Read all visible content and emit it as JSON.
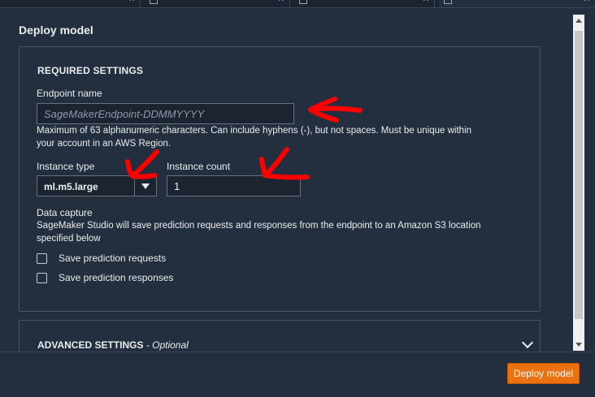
{
  "tabs": [
    {
      "name": "...",
      "active": false
    },
    {
      "name": "...",
      "active": false
    },
    {
      "name": "...",
      "active": false
    },
    {
      "name": "...",
      "active": true
    }
  ],
  "dialog": {
    "title": "Deploy model"
  },
  "required": {
    "section_title": "REQUIRED SETTINGS",
    "endpoint_label": "Endpoint name",
    "endpoint_placeholder": "SageMakerEndpoint-DDMMYYYY",
    "endpoint_hint_line1": "Maximum of 63 alphanumeric characters. Can include hyphens (-), but not spaces. Must be unique within",
    "endpoint_hint_line2": "your account in an AWS Region.",
    "instance_type_label": "Instance type",
    "instance_type_value": "ml.m5.large",
    "instance_count_label": "Instance count",
    "instance_count_value": "1",
    "data_capture_label": "Data capture",
    "data_capture_desc_line1": "SageMaker Studio will save prediction requests and responses from the endpoint to an Amazon S3 location",
    "data_capture_desc_line2": "specified below",
    "save_requests_label": "Save prediction requests",
    "save_responses_label": "Save prediction responses",
    "save_requests_checked": false,
    "save_responses_checked": false
  },
  "advanced": {
    "title": "ADVANCED SETTINGS",
    "optional": "- Optional"
  },
  "footer": {
    "deploy_button": "Deploy model"
  },
  "colors": {
    "background": "#232f3e",
    "accent": "#ec7211",
    "annotation": "#ff0000"
  },
  "icons": [
    "close-icon",
    "dropdown-caret-icon",
    "chevron-down-icon"
  ]
}
